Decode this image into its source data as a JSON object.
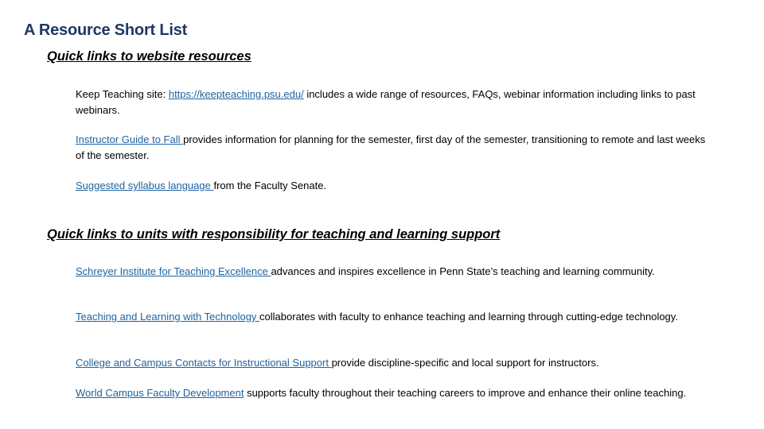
{
  "title": "A Resource Short List",
  "sections": [
    {
      "heading": "Quick links to website resources",
      "items": [
        {
          "prefix": "Keep Teaching site: ",
          "link": "https://keepteaching.psu.edu/",
          "text": " includes a wide range of resources, FAQs, webinar information including links to past webinars."
        },
        {
          "prefix": "",
          "link": "Instructor Guide to Fall ",
          "text": "provides information for planning for the semester, first day of the semester, transitioning to remote and last weeks of the semester."
        },
        {
          "prefix": "",
          "link": "Suggested syllabus language ",
          "text": "from the Faculty Senate."
        }
      ]
    },
    {
      "heading": "Quick links to units with responsibility for teaching and learning support",
      "items": [
        {
          "prefix": "",
          "link": "Schreyer Institute for Teaching Excellence ",
          "text": "advances and inspires excellence in Penn State’s teaching and learning community."
        },
        {
          "prefix": "",
          "link": "Teaching and Learning with Technology ",
          "text": "collaborates with faculty to enhance teaching and learning through cutting-edge technology."
        },
        {
          "prefix": "",
          "link": "College and Campus Contacts for Instructional Support ",
          "text": "provide discipline-specific and local support for instructors."
        },
        {
          "prefix": "",
          "link": "World Campus Faculty Development",
          "text": " supports faculty throughout their teaching careers to improve and enhance their online teaching."
        }
      ]
    }
  ],
  "colors": {
    "title": "#1f3864",
    "link": "#1f63a0",
    "text": "#000000"
  }
}
